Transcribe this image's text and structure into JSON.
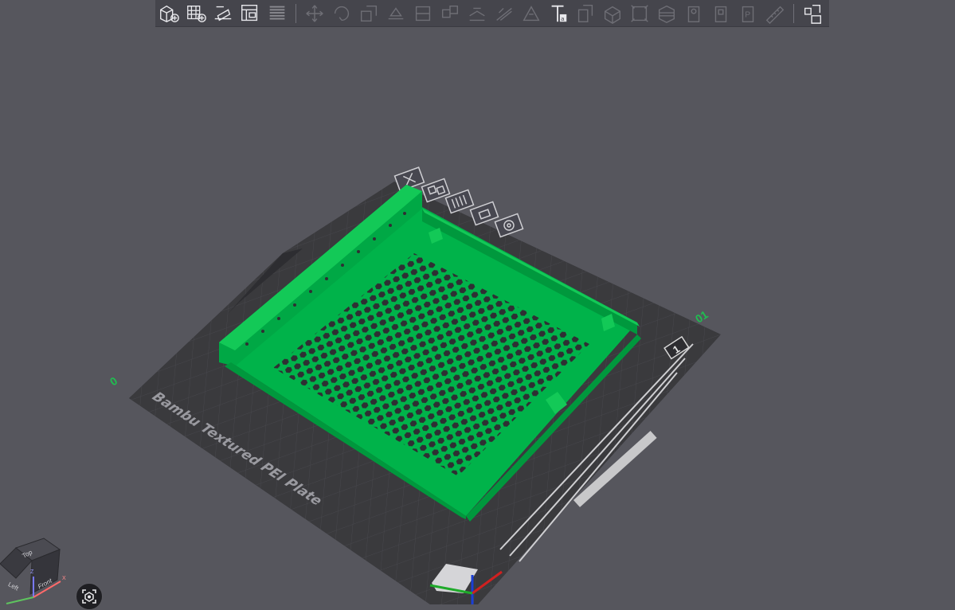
{
  "toolbar": {
    "left_tools": [
      "add-object",
      "add-plate",
      "auto-orient",
      "arrange",
      "layers"
    ],
    "mid_tools": [
      "move",
      "rotate",
      "scale",
      "lay-on-face",
      "cut",
      "split-objects",
      "split-parts",
      "support-paint",
      "seam-paint",
      "text",
      "mesh-boolean",
      "measure",
      "assembly",
      "variable-layer-height",
      "brim-ears",
      "color-paint",
      "emboss",
      "ruler"
    ],
    "right_tools": [
      "assembly-view"
    ]
  },
  "plate": {
    "name": "Bambu Textured PEI Plate",
    "plate_number": "1",
    "colors": {
      "bed": "#353538",
      "grid": "#4d4d52",
      "model": "#00b34a",
      "model_dark": "#00983d",
      "model_light": "#13c957"
    },
    "axis_marks": {
      "left": "0",
      "right": "01"
    }
  },
  "plate_controls": [
    "delete-plate",
    "arrange-plate",
    "orient-plate",
    "lock-plate",
    "plate-settings"
  ],
  "view_cube": {
    "top": "Top",
    "left": "Left",
    "front": "Front",
    "axes": [
      "X",
      "Y",
      "Z"
    ]
  },
  "camera": {
    "icon": "camera-reset-icon"
  }
}
